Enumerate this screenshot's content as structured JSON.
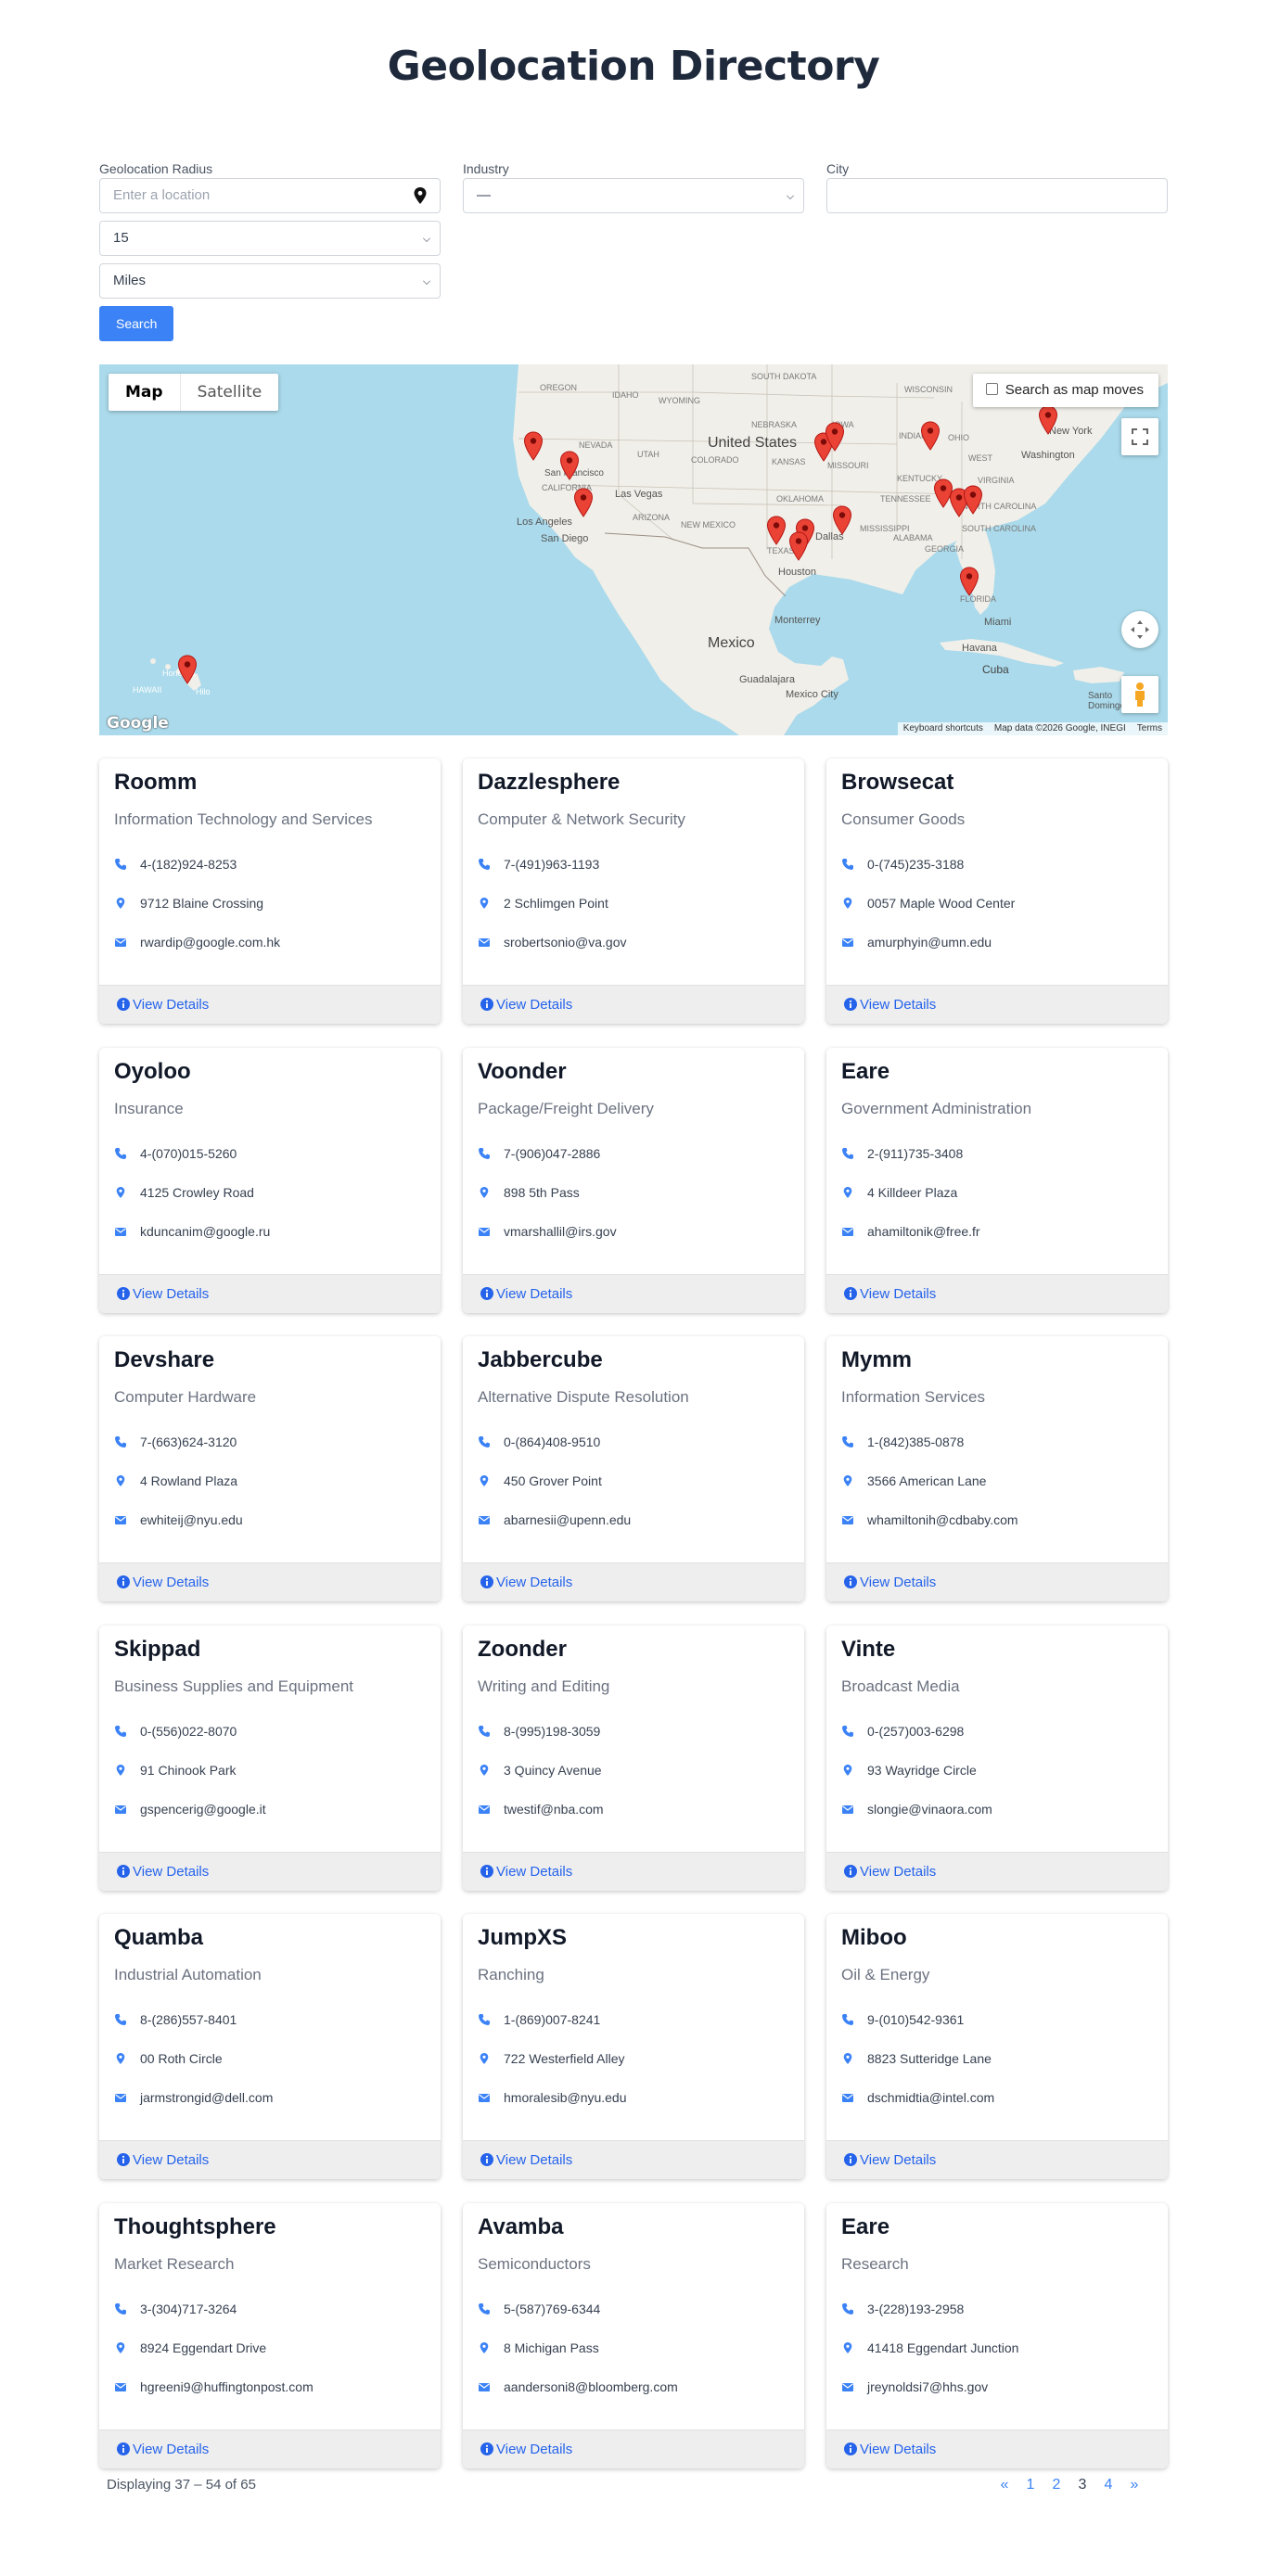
{
  "page": {
    "title": "Geolocation Directory"
  },
  "filters": {
    "radius_label": "Geolocation Radius",
    "location_placeholder": "Enter a location",
    "distance_value": "15",
    "unit_value": "Miles",
    "search_label": "Search",
    "industry_label": "Industry",
    "industry_value": "—",
    "city_label": "City",
    "city_value": ""
  },
  "map": {
    "type_map": "Map",
    "type_satellite": "Satellite",
    "search_as_moves": "Search as map moves",
    "attribution": [
      "Keyboard shortcuts",
      "Map data ©2026 Google, INEGI",
      "Terms"
    ],
    "logo": "Google",
    "labels": {
      "country_us": "United States",
      "country_mx": "Mexico",
      "cuba": "Cuba",
      "oregon": "OREGON",
      "idaho": "IDAHO",
      "wyoming": "WYOMING",
      "nevada": "NEVADA",
      "utah": "UTAH",
      "colorado": "COLORADO",
      "california": "CALIFORNIA",
      "arizona": "ARIZONA",
      "new_mexico": "NEW MEXICO",
      "nebraska": "NEBRASKA",
      "kansas": "KANSAS",
      "oklahoma": "OKLAHOMA",
      "texas": "TEXAS",
      "missouri": "MISSOURI",
      "south_dakota": "SOUTH DAKOTA",
      "wisconsin": "WISCONSIN",
      "indiana": "INDIANA",
      "ohio": "OHIO",
      "kentucky": "KENTUCKY",
      "tennessee": "TENNESSEE",
      "virginia": "VIRGINIA",
      "north_carolina": "NORTH CAROLINA",
      "south_carolina": "SOUTH CAROLINA",
      "alabama": "ALABAMA",
      "georgia": "GEORGIA",
      "mississippi": "MISSISSIPPI",
      "florida": "FLORIDA",
      "hawaii": "HAWAII",
      "west": "WEST",
      "iowa": "IOWA",
      "san_francisco": "San Francisco",
      "las_vegas": "Las Vegas",
      "los_angeles": "Los Angeles",
      "san_diego": "San Diego",
      "dallas": "Dallas",
      "houston": "Houston",
      "new_york": "New York",
      "washington": "Washington",
      "miami": "Miami",
      "havana": "Havana",
      "monterrey": "Monterrey",
      "guadalajara": "Guadalajara",
      "mexico_city": "Mexico City",
      "santo_domingo": "Santo Domingo",
      "honolulu": "Honolulu",
      "hilo": "Hilo"
    }
  },
  "companies": [
    {
      "name": "Roomm",
      "industry": "Information Technology and Services",
      "phone": "4-(182)924-8253",
      "address": "9712 Blaine Crossing",
      "email": "rwardip@google.com.hk"
    },
    {
      "name": "Dazzlesphere",
      "industry": "Computer & Network Security",
      "phone": "7-(491)963-1193",
      "address": "2 Schlimgen Point",
      "email": "srobertsonio@va.gov"
    },
    {
      "name": "Browsecat",
      "industry": "Consumer Goods",
      "phone": "0-(745)235-3188",
      "address": "0057 Maple Wood Center",
      "email": "amurphyin@umn.edu"
    },
    {
      "name": "Oyoloo",
      "industry": "Insurance",
      "phone": "4-(070)015-5260",
      "address": "4125 Crowley Road",
      "email": "kduncanim@google.ru"
    },
    {
      "name": "Voonder",
      "industry": "Package/Freight Delivery",
      "phone": "7-(906)047-2886",
      "address": "898 5th Pass",
      "email": "vmarshallil@irs.gov"
    },
    {
      "name": "Eare",
      "industry": "Government Administration",
      "phone": "2-(911)735-3408",
      "address": "4 Killdeer Plaza",
      "email": "ahamiltonik@free.fr"
    },
    {
      "name": "Devshare",
      "industry": "Computer Hardware",
      "phone": "7-(663)624-3120",
      "address": "4 Rowland Plaza",
      "email": "ewhiteij@nyu.edu"
    },
    {
      "name": "Jabbercube",
      "industry": "Alternative Dispute Resolution",
      "phone": "0-(864)408-9510",
      "address": "450 Grover Point",
      "email": "abarnesii@upenn.edu"
    },
    {
      "name": "Mymm",
      "industry": "Information Services",
      "phone": "1-(842)385-0878",
      "address": "3566 American Lane",
      "email": "whamiltonih@cdbaby.com"
    },
    {
      "name": "Skippad",
      "industry": "Business Supplies and Equipment",
      "phone": "0-(556)022-8070",
      "address": "91 Chinook Park",
      "email": "gspencerig@google.it"
    },
    {
      "name": "Zoonder",
      "industry": "Writing and Editing",
      "phone": "8-(995)198-3059",
      "address": "3 Quincy Avenue",
      "email": "twestif@nba.com"
    },
    {
      "name": "Vinte",
      "industry": "Broadcast Media",
      "phone": "0-(257)003-6298",
      "address": "93 Wayridge Circle",
      "email": "slongie@vinaora.com"
    },
    {
      "name": "Quamba",
      "industry": "Industrial Automation",
      "phone": "8-(286)557-8401",
      "address": "00 Roth Circle",
      "email": "jarmstrongid@dell.com"
    },
    {
      "name": "JumpXS",
      "industry": "Ranching",
      "phone": "1-(869)007-8241",
      "address": "722 Westerfield Alley",
      "email": "hmoralesib@nyu.edu"
    },
    {
      "name": "Miboo",
      "industry": "Oil & Energy",
      "phone": "9-(010)542-9361",
      "address": "8823 Sutteridge Lane",
      "email": "dschmidtia@intel.com"
    },
    {
      "name": "Thoughtsphere",
      "industry": "Market Research",
      "phone": "3-(304)717-3264",
      "address": "8924 Eggendart Drive",
      "email": "hgreeni9@huffingtonpost.com"
    },
    {
      "name": "Avamba",
      "industry": "Semiconductors",
      "phone": "5-(587)769-6344",
      "address": "8 Michigan Pass",
      "email": "aandersoni8@bloomberg.com"
    },
    {
      "name": "Eare",
      "industry": "Research",
      "phone": "3-(228)193-2958",
      "address": "41418 Eggendart Junction",
      "email": "jreynoldsi7@hhs.gov"
    }
  ],
  "card_labels": {
    "view_details": "View Details"
  },
  "pagination": {
    "displaying": "Displaying 37 – 54 of 65",
    "prev": "«",
    "pages": [
      "1",
      "2",
      "3",
      "4"
    ],
    "current": "3",
    "next": "»"
  },
  "colors": {
    "accent": "#3b82f6",
    "link": "#2563eb",
    "marker": "#ea4335",
    "water": "#aadaeb",
    "land": "#f1efe9"
  }
}
